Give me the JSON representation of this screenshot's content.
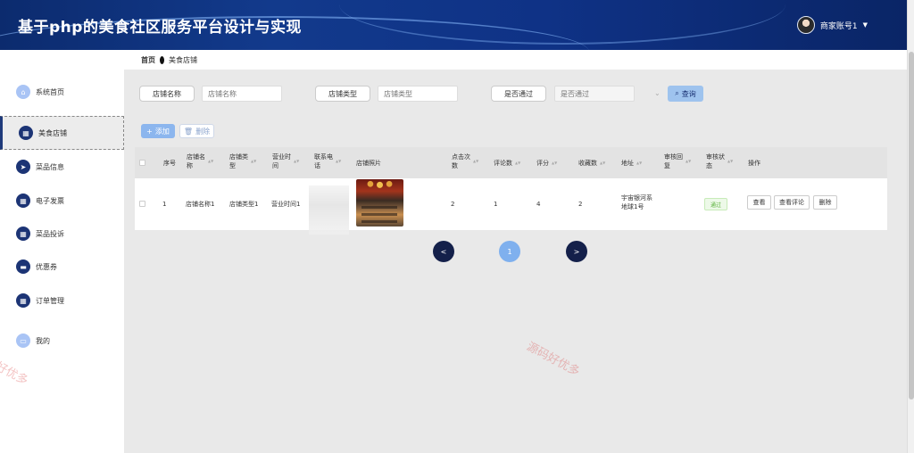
{
  "header": {
    "title": "基于php的美食社区服务平台设计与实现",
    "username": "商家账号1"
  },
  "breadcrumb": {
    "home": "首页",
    "current": "美食店铺"
  },
  "sidebar": {
    "items": [
      {
        "label": "系统首页",
        "icon": "home-icon"
      },
      {
        "label": "美食店铺",
        "icon": "grid-icon"
      },
      {
        "label": "菜品信息",
        "icon": "send-icon"
      },
      {
        "label": "电子发票",
        "icon": "grid-icon"
      },
      {
        "label": "菜品投诉",
        "icon": "grid-icon"
      },
      {
        "label": "优惠券",
        "icon": "ticket-icon"
      },
      {
        "label": "订单管理",
        "icon": "grid-icon"
      },
      {
        "label": "我的",
        "icon": "user-icon"
      }
    ]
  },
  "search": {
    "shop_name_label": "店铺名称",
    "shop_name_placeholder": "店铺名称",
    "shop_type_label": "店铺类型",
    "shop_type_placeholder": "店铺类型",
    "passed_label": "是否通过",
    "passed_placeholder": "是否通过",
    "query": "查询"
  },
  "actions": {
    "add": "添加",
    "delete": "删除"
  },
  "table": {
    "headers": {
      "index": "序号",
      "name_1": "店铺名",
      "name_2": "称",
      "type_1": "店铺类",
      "type_2": "型",
      "hours_1": "营业时",
      "hours_2": "间",
      "phone_1": "联系电",
      "phone_2": "话",
      "photo": "店铺照片",
      "clicks_1": "点击次",
      "clicks_2": "数",
      "reviews": "评论数",
      "score": "评分",
      "favorites": "收藏数",
      "address": "地址",
      "reply_1": "审核回",
      "reply_2": "复",
      "status_1": "审核状",
      "status_2": "态",
      "ops": "操作"
    },
    "row": {
      "index": "1",
      "name": "店铺名称1",
      "type": "店铺类型1",
      "hours": "营业时间1",
      "clicks": "2",
      "reviews": "1",
      "score": "4",
      "favorites": "2",
      "address_1": "宇宙银河系",
      "address_2": "地球1号",
      "status": "通过",
      "view": "查看",
      "view_reviews": "查看评论",
      "remove": "删除"
    }
  },
  "pagination": {
    "prev": "<",
    "current": "1",
    "next": ">"
  },
  "watermark": "源码好优多",
  "colors": {
    "header": "#0f3286",
    "accent": "#1c3475",
    "primary_light": "#8cb6ee"
  }
}
